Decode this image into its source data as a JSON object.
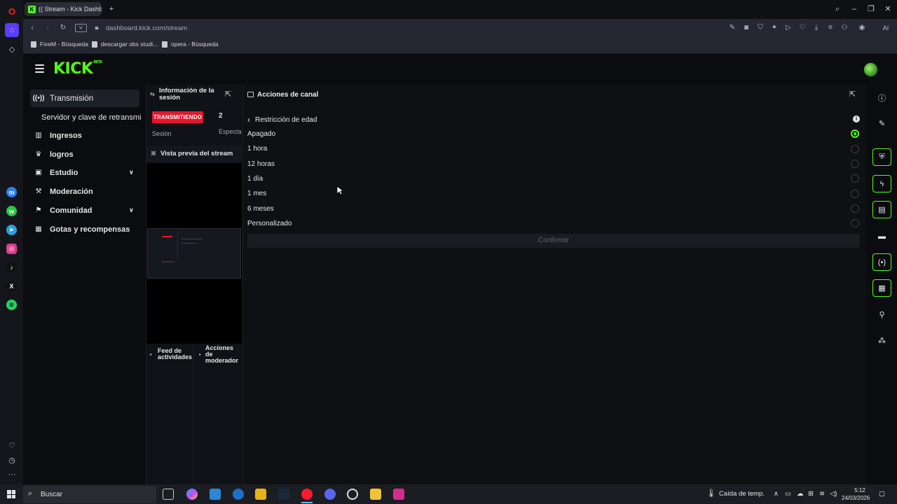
{
  "browser": {
    "tab_title": "(( Stream - Kick Dashbo...",
    "url": "dashboard.kick.com/stream",
    "ai_label": "AI",
    "bookmarks": [
      "FiveM - Búsqueda",
      "descargar obs studi...",
      "opera - Búsqueda"
    ]
  },
  "kick": {
    "logo": "KICK",
    "logo_badge": "BETA"
  },
  "sidebar": {
    "items": [
      {
        "label": "Transmisión",
        "icon": "broadcast-icon"
      },
      {
        "label": "Servidor y clave de retransmi",
        "icon": ""
      },
      {
        "label": "Ingresos",
        "icon": "chart-icon"
      },
      {
        "label": "logros",
        "icon": "trophy-icon"
      },
      {
        "label": "Estudio",
        "icon": "studio-icon"
      },
      {
        "label": "Moderación",
        "icon": "hammer-icon"
      },
      {
        "label": "Comunidad",
        "icon": "community-icon"
      },
      {
        "label": "Gotas y recompensas",
        "icon": "gift-icon"
      }
    ]
  },
  "session": {
    "title": "Información de la sesión",
    "live_badge": "TRANSMITIENDO",
    "count": "2",
    "session_label": "Sesión",
    "spectators_label": "Especta",
    "preview_title": "Vista previa del stream",
    "tab_feed": "Feed de actividades",
    "tab_mod": "Acciones de moderador"
  },
  "panel": {
    "title": "Acciones de canal",
    "back_label": "Restricción de edad",
    "options": [
      {
        "label": "Apagado",
        "selected": true
      },
      {
        "label": "1 hora",
        "selected": false
      },
      {
        "label": "12 horas",
        "selected": false
      },
      {
        "label": "1 día",
        "selected": false
      },
      {
        "label": "1 mes",
        "selected": false
      },
      {
        "label": "6 meses",
        "selected": false
      },
      {
        "label": "Personalizado",
        "selected": false
      }
    ],
    "confirm_label": "Confirmar"
  },
  "taskbar": {
    "search_placeholder": "Buscar",
    "weather": "Caída de temp.",
    "time": "5:12",
    "date": "24/03/2026"
  },
  "colors": {
    "accent": "#53fc18",
    "live": "#e5162b"
  }
}
